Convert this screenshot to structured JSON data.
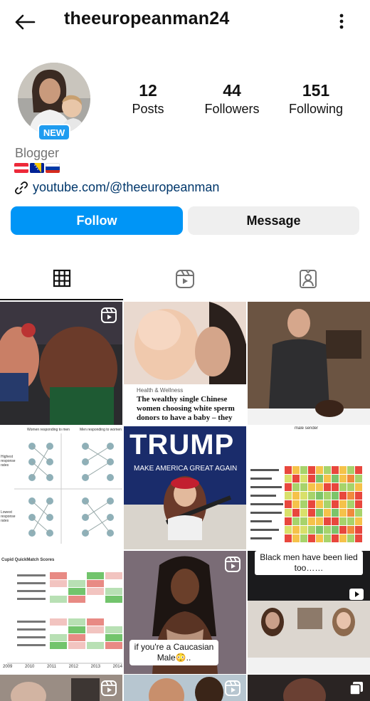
{
  "header": {
    "username": "theeuropeanman24",
    "back_icon": "arrow-left-icon",
    "more_icon": "more-vertical-icon"
  },
  "profile": {
    "badge": "NEW",
    "stats": [
      {
        "value": "12",
        "label": "Posts"
      },
      {
        "value": "44",
        "label": "Followers"
      },
      {
        "value": "151",
        "label": "Following"
      }
    ],
    "category": "Blogger",
    "flags": [
      "austria-flag",
      "bosnia-flag",
      "russia-flag"
    ],
    "link": "youtube.com/@theeuropeanman"
  },
  "actions": {
    "follow": "Follow",
    "message": "Message"
  },
  "tabs": [
    {
      "icon": "grid-icon",
      "active": true
    },
    {
      "icon": "reels-icon",
      "active": false
    },
    {
      "icon": "tagged-icon",
      "active": false
    }
  ],
  "posts": {
    "p2_category": "Health & Wellness",
    "p2_headline": "The wealthy single Chinese women choosing white sperm donors to have a baby – they",
    "p4_left_header": "Women responding to men",
    "p4_right_header": "Men responding to women",
    "p4_row1": "Highest response rates",
    "p4_row2": "Lowest response rates",
    "p5_banner": "TRUMP",
    "p5_sub": "MAKE AMERICA GREAT AGAIN",
    "p6_title": "male sender",
    "p7_title": "Cupid QuickMatch Scores",
    "p7_years": [
      "2009",
      "2010",
      "2011",
      "2012",
      "2013",
      "2014"
    ],
    "p8_caption": "if you're a Caucasian Male😳..",
    "p9_caption": "Black men have been lied too……"
  },
  "colors": {
    "accent": "#0095f6",
    "badge": "#1f9cf0",
    "link": "#00376b",
    "muted": "#737373"
  }
}
